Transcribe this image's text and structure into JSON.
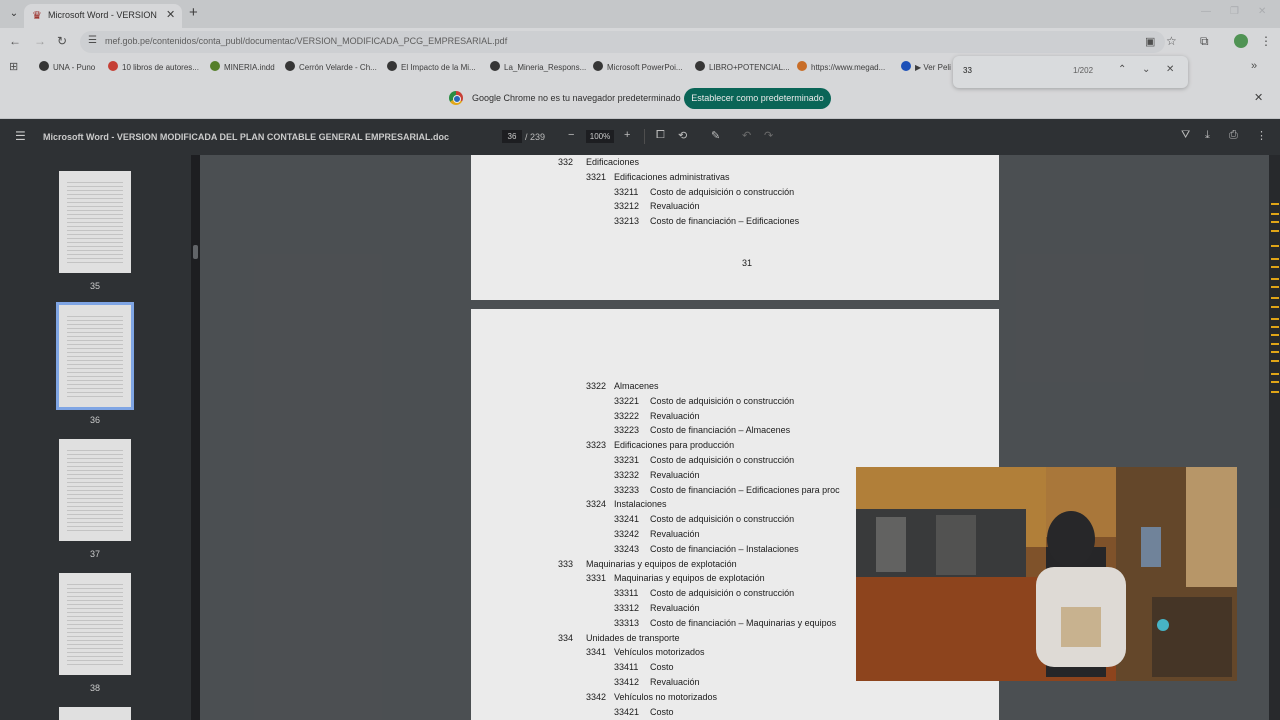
{
  "tab": {
    "title": "Microsoft Word - VERSION MO",
    "close": "✕",
    "new": "+"
  },
  "address": {
    "url": "mef.gob.pe/contenidos/conta_publ/documentac/VERSION_MODIFICADA_PCG_EMPRESARIAL.pdf"
  },
  "bookmarks": [
    {
      "label": "UNA - Puno",
      "color": "#3b3b3b"
    },
    {
      "label": "10 libros de autores...",
      "color": "#d6453a"
    },
    {
      "label": "MINERIA.indd",
      "color": "#5d8a2e"
    },
    {
      "label": "Cerrón Velarde - Ch...",
      "color": "#3b3b3b"
    },
    {
      "label": "El Impacto de la Mi...",
      "color": "#3b3b3b"
    },
    {
      "label": "La_Mineria_Respons...",
      "color": "#3b3b3b"
    },
    {
      "label": "Microsoft PowerPoi...",
      "color": "#3b3b3b"
    },
    {
      "label": "LIBRO+POTENCIAL...",
      "color": "#3b3b3b"
    },
    {
      "label": "https://www.megad...",
      "color": "#d9772b"
    },
    {
      "label": "▶ Ver Peli",
      "color": "#1f57c8"
    }
  ],
  "find": {
    "query": "33",
    "count": "1/202"
  },
  "infobar": {
    "message": "Google Chrome no es tu navegador predeterminado",
    "button": "Establecer como predeterminado"
  },
  "pdf": {
    "title": "Microsoft Word - VERSION MODIFICADA DEL PLAN CONTABLE GENERAL EMPRESARIAL.doc",
    "page": "36",
    "total": "/ 239",
    "zoom": "100%"
  },
  "thumbnails": [
    {
      "num": "35"
    },
    {
      "num": "36"
    },
    {
      "num": "37"
    },
    {
      "num": "38"
    }
  ],
  "page1": {
    "lines": [
      {
        "code": "332",
        "text": "Edificaciones"
      },
      {
        "code": "3321",
        "text": "Edificaciones administrativas"
      },
      {
        "code": "33211",
        "text": "Costo de adquisición o construcción"
      },
      {
        "code": "33212",
        "text": "Revaluación"
      },
      {
        "code": "33213",
        "text": "Costo de financiación – Edificaciones"
      }
    ],
    "pagenum": "31"
  },
  "page2": {
    "lines": [
      {
        "code": "3322",
        "text": "Almacenes"
      },
      {
        "code": "33221",
        "text": "Costo de adquisición o construcción"
      },
      {
        "code": "33222",
        "text": "Revaluación"
      },
      {
        "code": "33223",
        "text": "Costo de financiación – Almacenes"
      },
      {
        "code": "3323",
        "text": "Edificaciones para producción"
      },
      {
        "code": "33231",
        "text": "Costo de adquisición o construcción"
      },
      {
        "code": "33232",
        "text": "Revaluación"
      },
      {
        "code": "33233",
        "text": "Costo de financiación – Edificaciones para proc"
      },
      {
        "code": "3324",
        "text": "Instalaciones"
      },
      {
        "code": "33241",
        "text": "Costo de adquisición o construcción"
      },
      {
        "code": "33242",
        "text": "Revaluación"
      },
      {
        "code": "33243",
        "text": "Costo de financiación – Instalaciones"
      },
      {
        "code": "333",
        "text": "Maquinarias y equipos de explotación"
      },
      {
        "code": "3331",
        "text": "Maquinarias y equipos de explotación"
      },
      {
        "code": "33311",
        "text": "Costo de adquisición o construcción"
      },
      {
        "code": "33312",
        "text": "Revaluación"
      },
      {
        "code": "33313",
        "text": "Costo de financiación – Maquinarias y equipos"
      },
      {
        "code": "334",
        "text": "Unidades de transporte"
      },
      {
        "code": "3341",
        "text": "Vehículos motorizados"
      },
      {
        "code": "33411",
        "text": "Costo"
      },
      {
        "code": "33412",
        "text": "Revaluación"
      },
      {
        "code": "3342",
        "text": "Vehículos no motorizados"
      },
      {
        "code": "33421",
        "text": "Costo"
      }
    ]
  }
}
